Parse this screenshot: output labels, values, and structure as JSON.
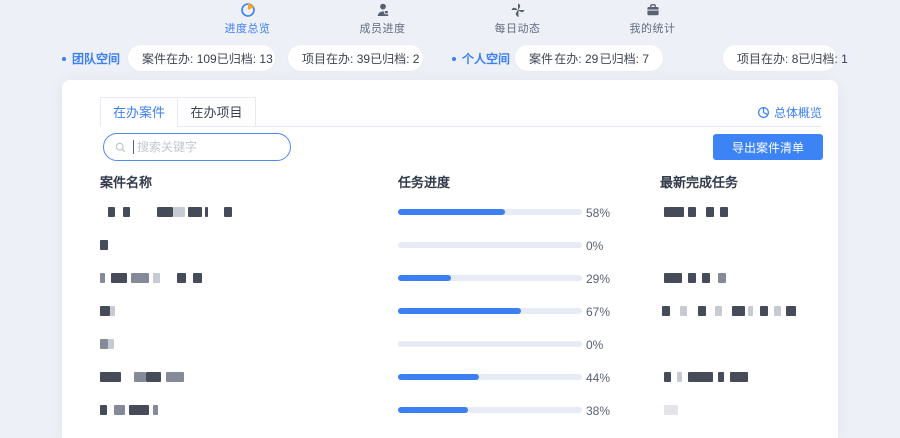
{
  "colors": {
    "accent": "#3b7ff2",
    "page_bg": "#eef0f7",
    "progress_track": "#e7ebf5",
    "progress_fill": "#3b7ff2",
    "nav_inactive": "#636b7e",
    "pie_icon_wedge": "#f5a623"
  },
  "nav": {
    "items": [
      {
        "label": "进度总览",
        "icon": "pie-chart-icon",
        "active": true
      },
      {
        "label": "成员进度",
        "icon": "member-icon",
        "active": false
      },
      {
        "label": "每日动态",
        "icon": "pinwheel-icon",
        "active": false
      },
      {
        "label": "我的统计",
        "icon": "briefcase-icon",
        "active": false
      }
    ]
  },
  "workspace_bar": {
    "team_label": "团队空间",
    "personal_label": "个人空间",
    "team_pills": [
      {
        "name": "案件",
        "k1": "在办:",
        "v1": "109",
        "k2": "已归档:",
        "v2": "13"
      },
      {
        "name": "项目",
        "k1": "在办:",
        "v1": "39",
        "k2": "已归档:",
        "v2": "2"
      }
    ],
    "personal_pills": [
      {
        "name": "案件",
        "k1": "在办:",
        "v1": "29",
        "k2": "已归档:",
        "v2": "7"
      },
      {
        "name": "项目",
        "k1": "在办:",
        "v1": "8",
        "k2": "已归档:",
        "v2": "1"
      }
    ]
  },
  "card": {
    "tabs": [
      {
        "label": "在办案件",
        "active": true
      },
      {
        "label": "在办项目",
        "active": false
      }
    ],
    "overview_link": "总体概览",
    "search_placeholder": "搜索关键字",
    "export_button": "导出案件清单",
    "table": {
      "headers": [
        "案件名称",
        "任务进度",
        "最新完成任务"
      ],
      "rows": [
        {
          "progress_pct": 58,
          "progress_label": "58%",
          "name_blocks": [
            [
              8,
              7,
              "d"
            ],
            [
              23,
              7,
              "d"
            ],
            [
              57,
              16,
              "d"
            ],
            [
              73,
              12,
              "l"
            ],
            [
              88,
              14,
              "d"
            ],
            [
              105,
              3,
              "d"
            ],
            [
              124,
              8,
              "d"
            ]
          ],
          "task_blocks": [
            [
              4,
              20,
              "d"
            ],
            [
              28,
              8,
              "d"
            ],
            [
              46,
              8,
              "d"
            ],
            [
              60,
              8,
              "d"
            ]
          ]
        },
        {
          "progress_pct": 0,
          "progress_label": "0%",
          "name_blocks": [
            [
              0,
              8,
              "d"
            ]
          ],
          "task_blocks": []
        },
        {
          "progress_pct": 29,
          "progress_label": "29%",
          "name_blocks": [
            [
              0,
              5,
              "m"
            ],
            [
              11,
              16,
              "d"
            ],
            [
              31,
              18,
              "m"
            ],
            [
              53,
              7,
              "l"
            ],
            [
              77,
              9,
              "d"
            ],
            [
              93,
              9,
              "d"
            ]
          ],
          "task_blocks": [
            [
              4,
              18,
              "d"
            ],
            [
              28,
              8,
              "d"
            ],
            [
              42,
              8,
              "d"
            ],
            [
              58,
              8,
              "m"
            ]
          ]
        },
        {
          "progress_pct": 67,
          "progress_label": "67%",
          "name_blocks": [
            [
              0,
              10,
              "d"
            ],
            [
              10,
              5,
              "l"
            ]
          ],
          "task_blocks": [
            [
              2,
              8,
              "d"
            ],
            [
              20,
              7,
              "l"
            ],
            [
              38,
              8,
              "d"
            ],
            [
              55,
              7,
              "l"
            ],
            [
              72,
              13,
              "d"
            ],
            [
              88,
              5,
              "l"
            ],
            [
              100,
              8,
              "d"
            ],
            [
              114,
              7,
              "l"
            ],
            [
              126,
              10,
              "d"
            ]
          ]
        },
        {
          "progress_pct": 0,
          "progress_label": "0%",
          "name_blocks": [
            [
              0,
              8,
              "m"
            ],
            [
              8,
              6,
              "l"
            ]
          ],
          "task_blocks": []
        },
        {
          "progress_pct": 44,
          "progress_label": "44%",
          "name_blocks": [
            [
              0,
              21,
              "d"
            ],
            [
              34,
              12,
              "m"
            ],
            [
              46,
              15,
              "d"
            ],
            [
              66,
              18,
              "m"
            ]
          ],
          "task_blocks": [
            [
              4,
              7,
              "d"
            ],
            [
              17,
              5,
              "l"
            ],
            [
              28,
              25,
              "d"
            ],
            [
              58,
              6,
              "d"
            ],
            [
              70,
              18,
              "d"
            ]
          ]
        },
        {
          "progress_pct": 38,
          "progress_label": "38%",
          "name_blocks": [
            [
              0,
              7,
              "d"
            ],
            [
              14,
              11,
              "m"
            ],
            [
              29,
              20,
              "d"
            ],
            [
              53,
              5,
              "m"
            ]
          ],
          "task_blocks": [
            [
              4,
              14,
              "xl"
            ]
          ]
        }
      ]
    }
  }
}
